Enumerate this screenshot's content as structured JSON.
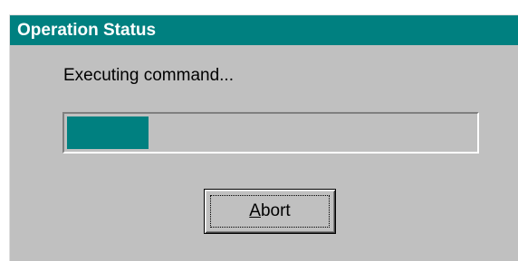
{
  "window": {
    "title": "Operation Status"
  },
  "status": {
    "message": "Executing command...",
    "progress_fraction": 0.2
  },
  "buttons": {
    "abort": {
      "label_mnemonic": "A",
      "label_rest": "bort"
    }
  },
  "colors": {
    "title_bar": "#008080",
    "progress_fill": "#008080",
    "dialog_face": "#c0c0c0"
  }
}
